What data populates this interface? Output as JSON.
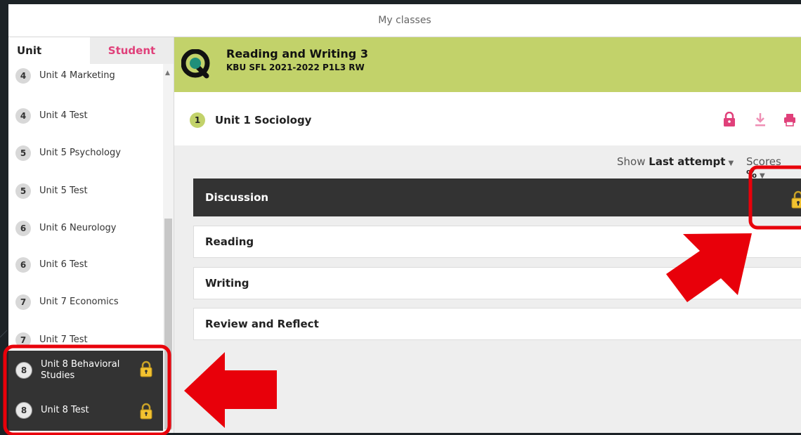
{
  "window": {
    "title": "My classes"
  },
  "sidebar": {
    "tab_unit": "Unit",
    "tab_student": "Student",
    "items": [
      {
        "num": "4",
        "label": "Unit 4 Marketing",
        "locked": false
      },
      {
        "num": "4",
        "label": "Unit 4 Test",
        "locked": false
      },
      {
        "num": "5",
        "label": "Unit 5 Psychology",
        "locked": false
      },
      {
        "num": "5",
        "label": "Unit 5 Test",
        "locked": false
      },
      {
        "num": "6",
        "label": "Unit 6 Neurology",
        "locked": false
      },
      {
        "num": "6",
        "label": "Unit 6 Test",
        "locked": false
      },
      {
        "num": "7",
        "label": "Unit 7 Economics",
        "locked": false
      },
      {
        "num": "7",
        "label": "Unit 7 Test",
        "locked": false
      },
      {
        "num": "8",
        "label": "Unit 8 Behavioral Studies",
        "locked": true
      },
      {
        "num": "8",
        "label": "Unit 8 Test",
        "locked": true
      }
    ]
  },
  "class_header": {
    "title": "Reading and Writing 3",
    "subtitle": "KBU SFL 2021-2022 P1L3 RW"
  },
  "unit_bar": {
    "num": "1",
    "label": "Unit 1 Sociology"
  },
  "toolbar": {
    "icons": [
      "lock-icon",
      "download-icon",
      "print-icon"
    ]
  },
  "filters": {
    "show_prefix": "Show",
    "show_value": "Last attempt",
    "scores_prefix": "Scores",
    "scores_value": "%"
  },
  "sections": [
    {
      "label": "Discussion",
      "locked": true
    },
    {
      "label": "Reading",
      "locked": false
    },
    {
      "label": "Writing",
      "locked": false
    },
    {
      "label": "Review and Reflect",
      "locked": false
    }
  ],
  "colors": {
    "accent_green": "#c2d26a",
    "accent_pink": "#e0407a",
    "dark_row": "#333333",
    "annotation_red": "#e8000a",
    "lock_gold": "#f2c230"
  }
}
